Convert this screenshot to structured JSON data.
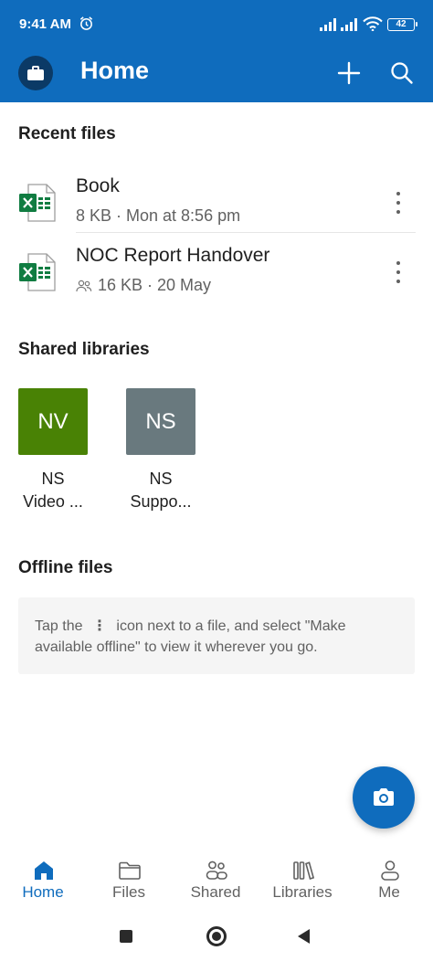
{
  "status_bar": {
    "time": "9:41 AM",
    "battery": "42"
  },
  "app_bar": {
    "title": "Home"
  },
  "recent": {
    "title": "Recent files",
    "files": [
      {
        "name": "Book",
        "meta": "8 KB · Mon at 8:56 pm",
        "shared": false,
        "type": "excel"
      },
      {
        "name": "NOC Report Handover",
        "meta": "16 KB · 20 May",
        "shared": true,
        "type": "excel"
      }
    ]
  },
  "libraries": {
    "title": "Shared libraries",
    "items": [
      {
        "initials": "NV",
        "label_line1": "NS",
        "label_line2": "Video ...",
        "color": "#498205"
      },
      {
        "initials": "NS",
        "label_line1": "NS",
        "label_line2": "Suppo...",
        "color": "#69797e"
      }
    ]
  },
  "offline": {
    "title": "Offline files",
    "hint_before": "Tap the",
    "hint_after": "icon next to a file, and select \"Make available offline\" to view it wherever you go."
  },
  "bottom_nav": {
    "items": [
      {
        "label": "Home",
        "icon": "home-icon",
        "active": true
      },
      {
        "label": "Files",
        "icon": "folder-icon",
        "active": false
      },
      {
        "label": "Shared",
        "icon": "people-icon",
        "active": false
      },
      {
        "label": "Libraries",
        "icon": "library-icon",
        "active": false
      },
      {
        "label": "Me",
        "icon": "person-icon",
        "active": false
      }
    ]
  },
  "colors": {
    "brand": "#0f6cbd",
    "excel": "#107c41"
  }
}
